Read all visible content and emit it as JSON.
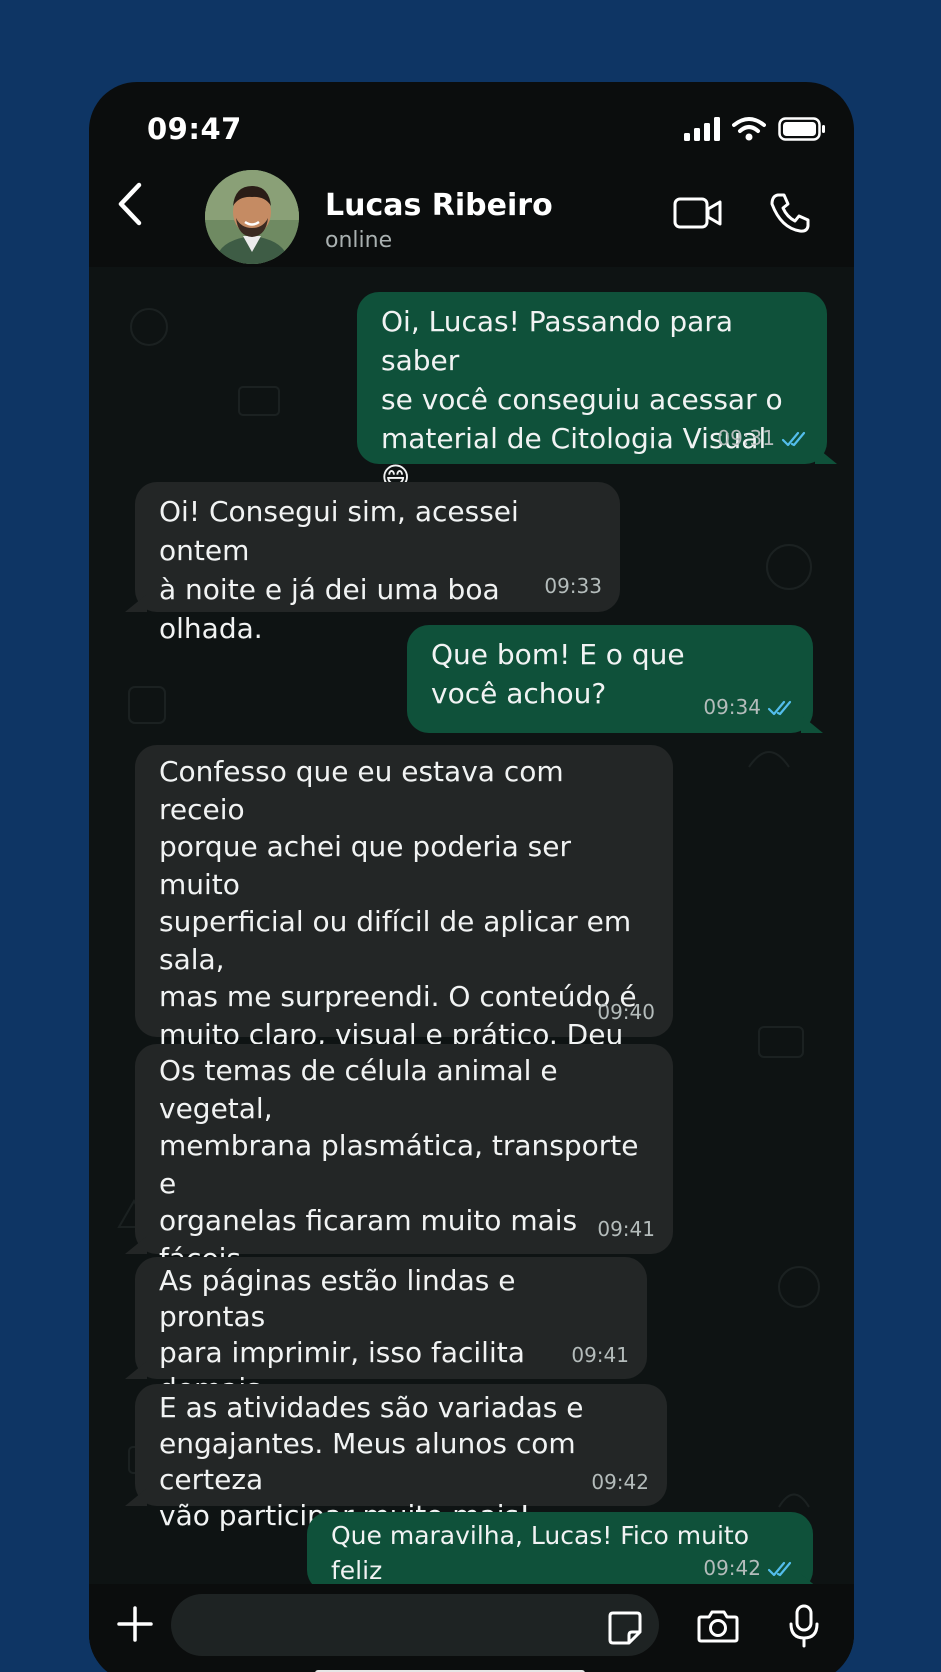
{
  "status_bar": {
    "time": "09:47"
  },
  "header": {
    "back_label": "back",
    "contact_name": "Lucas Ribeiro",
    "contact_status": "online"
  },
  "messages": [
    {
      "direction": "out",
      "text": "Oi, Lucas! Passando para saber\nse você conseguiu acessar o\nmaterial de Citologia Visual 😄",
      "time": "09:31",
      "read": true
    },
    {
      "direction": "in",
      "text": "Oi! Consegui sim, acessei ontem\nà noite e já dei uma boa olhada.",
      "time": "09:33"
    },
    {
      "direction": "out",
      "text": "Que bom! E o que\nvocê achou?",
      "time": "09:34",
      "read": true
    },
    {
      "direction": "in",
      "text": "Confesso que eu estava com receio\nporque achei que poderia ser muito\nsuperficial ou difícil de aplicar em sala,\nmas me surpreendi. O conteúdo é\nmuito claro, visual e prático. Deu para\nentender tudo e já imaginar usando\ncom meus alunos.",
      "time": "09:40"
    },
    {
      "direction": "in",
      "text": "Os temas de célula animal e vegetal,\nmembrana plasmática, transporte e\norganelas ficaram muito mais fáceis\nde explicar com os esquemas e\nilustrações.",
      "time": "09:41"
    },
    {
      "direction": "in",
      "text": "As páginas estão lindas e prontas\npara imprimir, isso facilita demais\nno dia a dia.",
      "time": "09:41"
    },
    {
      "direction": "in",
      "text": "E as atividades são variadas e\nengajantes. Meus alunos com certeza\nvão participar muito mais!",
      "time": "09:42"
    },
    {
      "direction": "out",
      "text": "Que maravilha, Lucas! Fico muito feliz\nem saber disso! Conte comigo! 🙌",
      "time": "09:42",
      "read": true
    }
  ],
  "composer": {
    "placeholder": ""
  },
  "colors": {
    "outgoing_bubble": "#0f513a",
    "incoming_bubble": "#232626",
    "read_ticks": "#53bdeb",
    "background": "#0e3564"
  }
}
